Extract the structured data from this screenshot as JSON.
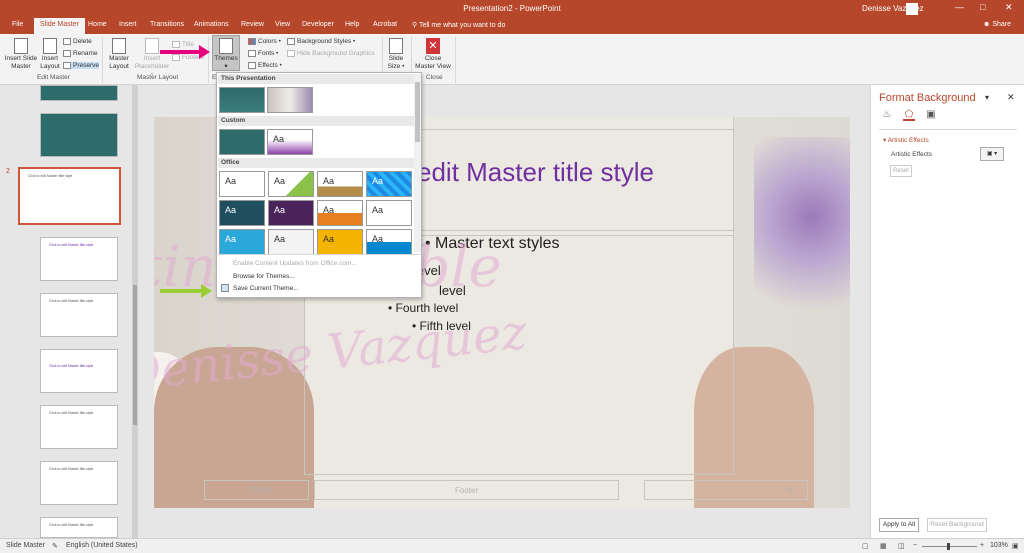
{
  "window": {
    "title": "Presentation2 - PowerPoint",
    "user": "Denisse Vazquez",
    "controls": [
      "—",
      "□",
      "✕"
    ]
  },
  "tabs": [
    "File",
    "Slide Master",
    "Home",
    "Insert",
    "Transitions",
    "Animations",
    "Review",
    "View",
    "Developer",
    "Help",
    "Acrobat"
  ],
  "tell_me": "Tell me what you want to do",
  "share": "Share",
  "ribbon": {
    "insert_slide_master": [
      "Insert Slide",
      "Master"
    ],
    "insert_layout": [
      "Insert",
      "Layout"
    ],
    "delete": "Delete",
    "rename": "Rename",
    "preserve": "Preserve",
    "edit_master_group": "Edit Master",
    "master_layout": [
      "Master",
      "Layout"
    ],
    "insert_placeholder": [
      "Insert",
      "Placeholder •"
    ],
    "title_check": "Title",
    "footers_check": "Footers",
    "master_layout_group": "Master Layout",
    "themes": "Themes",
    "colors": "Colors •",
    "fonts": "Fonts •",
    "effects": "Effects •",
    "background_styles": "Background Styles •",
    "hide_bg": "Hide Background Graphics",
    "slide_size": [
      "Slide",
      "Size •"
    ],
    "close_master_view": [
      "Close",
      "Master View"
    ],
    "close_group": "Close",
    "edit_theme_group_partial": "E"
  },
  "themes_menu": {
    "section_this_presentation": "This Presentation",
    "section_custom": "Custom",
    "section_office": "Office",
    "tile_text": "Aa",
    "enable_updates": "Enable Content Updates from Office.com...",
    "browse_themes": "Browse for Themes...",
    "save_current_theme": "Save Current Theme..."
  },
  "slide": {
    "title": "edit Master title style",
    "level1": "Master text styles",
    "level2": "level",
    "level3": "level",
    "level4": "Fourth level",
    "level5": "Fifth level",
    "date": "7/2019",
    "footer": "Footer",
    "page_number": "‹#›",
    "watermark1": "Creating Possible",
    "watermark2": "by Denisse Vazquez"
  },
  "thumbnails": {
    "selected_number": "2",
    "title_text": "Click to edit Master title style",
    "purple_text": "Click to edit Master title style"
  },
  "format_background": {
    "title": "Format Background",
    "section": "Artistic Effects",
    "artistic_effects_label": "Artistic Effects",
    "reset": "Reset",
    "apply_to_all": "Apply to All",
    "reset_background": "Reset Background"
  },
  "status": {
    "view": "Slide Master",
    "language": "English (United States)",
    "zoom": "103%"
  },
  "colors": {
    "accent": "#b7472a",
    "annotation_pink": "#e6007e",
    "annotation_green": "#9acd32"
  }
}
